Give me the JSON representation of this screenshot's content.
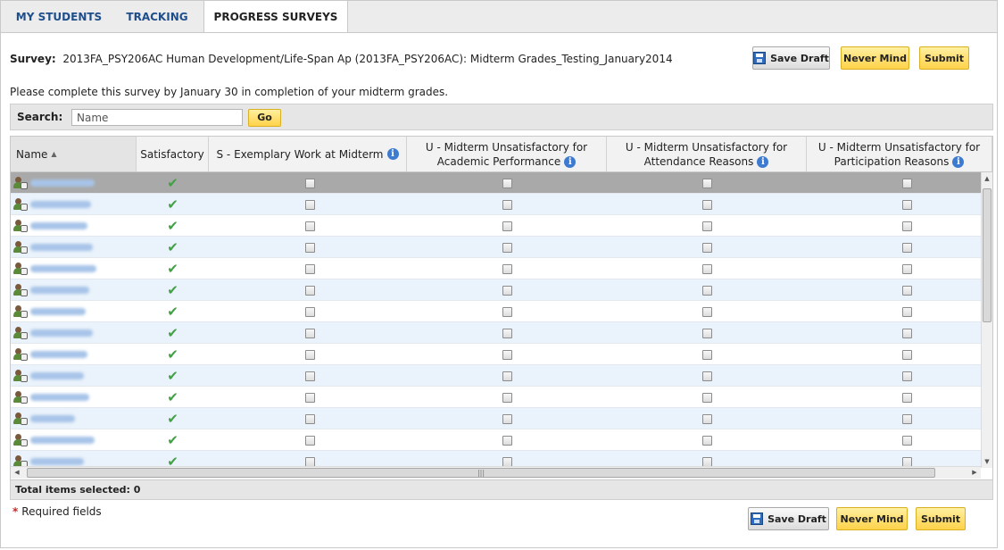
{
  "tabs": [
    {
      "label": "MY STUDENTS"
    },
    {
      "label": "TRACKING"
    },
    {
      "label": "PROGRESS SURVEYS"
    }
  ],
  "survey": {
    "label": "Survey:",
    "title": "2013FA_PSY206AC Human Development/Life-Span Ap (2013FA_PSY206AC): Midterm Grades_Testing_January2014",
    "instructions": "Please complete this survey by January 30 in completion of your midterm grades."
  },
  "buttons": {
    "save_draft": "Save Draft",
    "never_mind": "Never Mind",
    "submit": "Submit",
    "go": "Go"
  },
  "search": {
    "label": "Search:",
    "placeholder": "Name"
  },
  "columns": [
    {
      "label": "Name",
      "sort": "ascending"
    },
    {
      "label": "Satisfactory"
    },
    {
      "label": "S - Exemplary Work at Midterm",
      "info": true
    },
    {
      "label_line1": "U - Midterm Unsatisfactory for",
      "label_line2": "Academic Performance",
      "info": true
    },
    {
      "label_line1": "U - Midterm Unsatisfactory for",
      "label_line2": "Attendance Reasons",
      "info": true
    },
    {
      "label_line1": "U - Midterm Unsatisfactory for",
      "label_line2": "Participation Reasons",
      "info": true
    }
  ],
  "rows": [
    {
      "satisfactory": true,
      "checked": [
        false,
        false,
        false,
        false
      ],
      "selected": true
    },
    {
      "satisfactory": true,
      "checked": [
        false,
        false,
        false,
        false
      ]
    },
    {
      "satisfactory": true,
      "checked": [
        false,
        false,
        false,
        false
      ]
    },
    {
      "satisfactory": true,
      "checked": [
        false,
        false,
        false,
        false
      ]
    },
    {
      "satisfactory": true,
      "checked": [
        false,
        false,
        false,
        false
      ]
    },
    {
      "satisfactory": true,
      "checked": [
        false,
        false,
        false,
        false
      ]
    },
    {
      "satisfactory": true,
      "checked": [
        false,
        false,
        false,
        false
      ]
    },
    {
      "satisfactory": true,
      "checked": [
        false,
        false,
        false,
        false
      ]
    },
    {
      "satisfactory": true,
      "checked": [
        false,
        false,
        false,
        false
      ]
    },
    {
      "satisfactory": true,
      "checked": [
        false,
        false,
        false,
        false
      ]
    },
    {
      "satisfactory": true,
      "checked": [
        false,
        false,
        false,
        false
      ]
    },
    {
      "satisfactory": true,
      "checked": [
        false,
        false,
        false,
        false
      ]
    },
    {
      "satisfactory": true,
      "checked": [
        false,
        false,
        false,
        false
      ]
    },
    {
      "satisfactory": true,
      "checked": [
        false,
        false,
        false,
        false
      ]
    }
  ],
  "footer": {
    "total_selected": "Total items selected: 0",
    "required": "Required fields"
  },
  "colors": {
    "tab_link": "#1f4e8c",
    "accent_yellow": "#ffd24a",
    "row_alt": "#eaf2fb",
    "row_selected": "#a9a9a9",
    "check_green": "#43a047",
    "required_star": "#c62828"
  },
  "icons": {
    "save": "floppy-disk-icon",
    "student": "student-person-icon",
    "info": "info-icon",
    "satisfactory": "checkmark-icon"
  }
}
